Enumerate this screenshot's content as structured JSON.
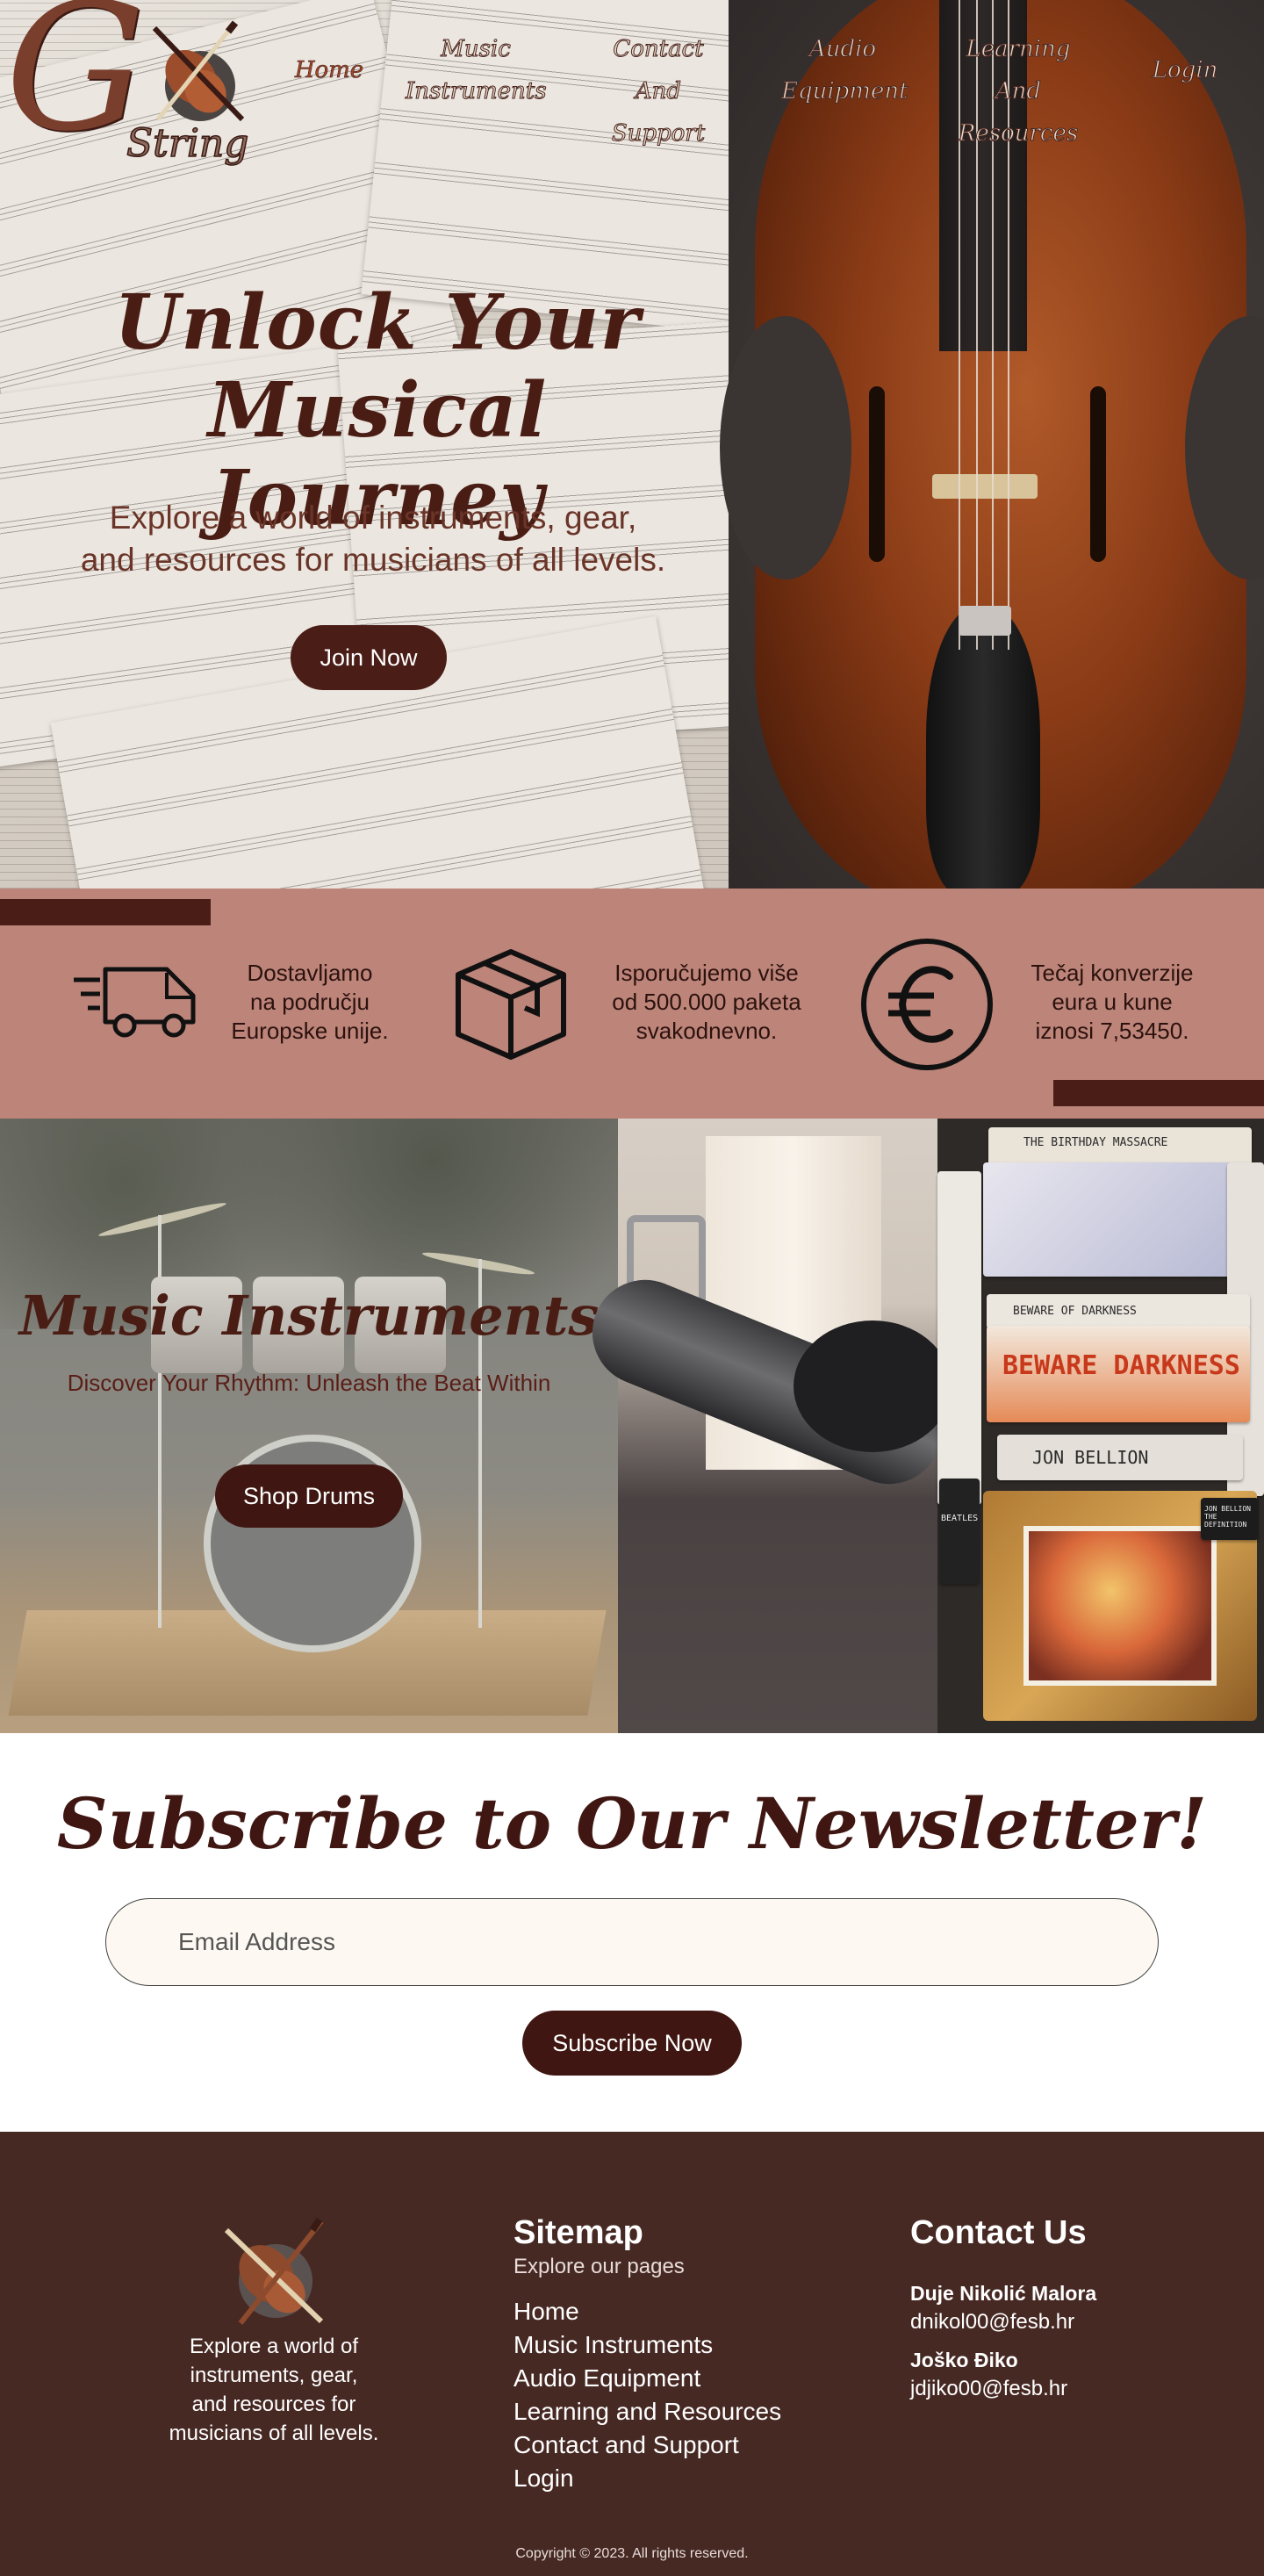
{
  "brand": {
    "logo_letter": "G",
    "logo_word": "String"
  },
  "nav": {
    "items": [
      {
        "line1": "Home",
        "line2": ""
      },
      {
        "line1": "Music",
        "line2": "Instruments"
      },
      {
        "line1": "Contact",
        "line2": "And Support"
      },
      {
        "line1": "Audio",
        "line2": "Equipment"
      },
      {
        "line1": "Learning",
        "line2": "And Resources"
      },
      {
        "line1": "Login",
        "line2": ""
      }
    ]
  },
  "hero": {
    "title_line1": "Unlock Your Musical",
    "title_line2": "Journey",
    "subtitle_line1": "Explore a world of instruments, gear,",
    "subtitle_line2": "and resources for musicians of all levels.",
    "cta_label": "Join Now"
  },
  "features": [
    {
      "icon": "delivery-truck-icon",
      "lines": [
        "Dostavljamo",
        "na području",
        "Europske unije."
      ]
    },
    {
      "icon": "package-box-icon",
      "lines": [
        "Isporučujemo više",
        "od 500.000 paketa",
        "svakodnevno."
      ]
    },
    {
      "icon": "euro-coin-icon",
      "lines": [
        "Tečaj konverzije",
        "eura u kune",
        "iznosi 7,53450."
      ]
    }
  ],
  "categories": {
    "featured_title": "Music Instruments",
    "featured_subtitle": "Discover Your Rhythm: Unleash the Beat Within",
    "featured_cta": "Shop Drums",
    "vinyl_labels": [
      "THE BIRTHDAY MASSACRE",
      "BEWARE OF DARKNESS",
      "BEWARE DARKNESS",
      "JON BELLION",
      "BEATLES",
      "JON BELLION THE DEFINITION"
    ]
  },
  "newsletter": {
    "title": "Subscribe to Our Newsletter!",
    "email_placeholder": "Email Address",
    "cta_label": "Subscribe Now"
  },
  "footer": {
    "about_lines": [
      "Explore a world of",
      "instruments, gear,",
      "and resources for",
      "musicians of all levels."
    ],
    "sitemap_title": "Sitemap",
    "sitemap_subtitle": "Explore our pages",
    "sitemap_links": [
      "Home",
      "Music Instruments",
      "Audio Equipment",
      "Learning and Resources",
      "Contact and Support",
      "Login"
    ],
    "contact_title": "Contact Us",
    "contacts": [
      {
        "name": "Duje Nikolić Malora",
        "email": "dnikol00@fesb.hr"
      },
      {
        "name": "Joško Điko",
        "email": "jdjiko00@fesb.hr"
      }
    ],
    "copyright": "Copyright © 2023. All rights reserved."
  },
  "colors": {
    "brand_dark": "#4a1d17",
    "feature_band": "#bd8479",
    "footer_bg": "#472924",
    "nav_active": "#a4462a"
  }
}
